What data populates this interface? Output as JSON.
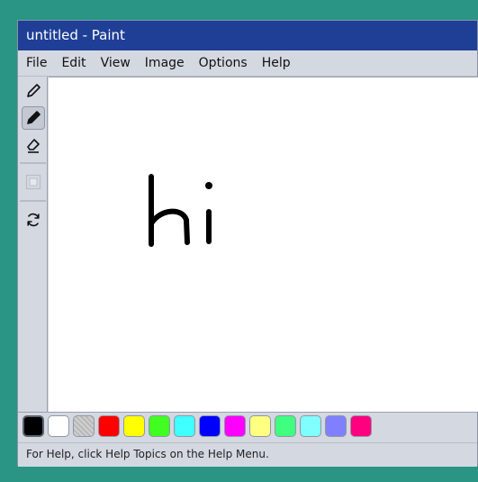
{
  "window": {
    "title": "untitled - Paint"
  },
  "menu": [
    "File",
    "Edit",
    "View",
    "Image",
    "Options",
    "Help"
  ],
  "tools": [
    {
      "name": "pencil-icon",
      "active": false
    },
    {
      "name": "brush-icon",
      "active": true
    },
    {
      "name": "eraser-icon",
      "active": false
    },
    {
      "name": "select-icon",
      "active": false,
      "disabled": true
    },
    {
      "name": "refresh-icon",
      "active": false
    }
  ],
  "palette": {
    "colors": [
      "#000000",
      "#ffffff",
      "#c0c0c0",
      "#ff0000",
      "#ffff00",
      "#40ff20",
      "#40ffff",
      "#0000ff",
      "#ff00ff",
      "#ffff80",
      "#40ff80",
      "#80ffff",
      "#8080ff",
      "#ff0080"
    ],
    "selected_index": 0
  },
  "canvas_drawing": {
    "text": "hi",
    "stroke_color": "#000000"
  },
  "status": {
    "text": "For Help, click Help Topics on the Help Menu."
  }
}
